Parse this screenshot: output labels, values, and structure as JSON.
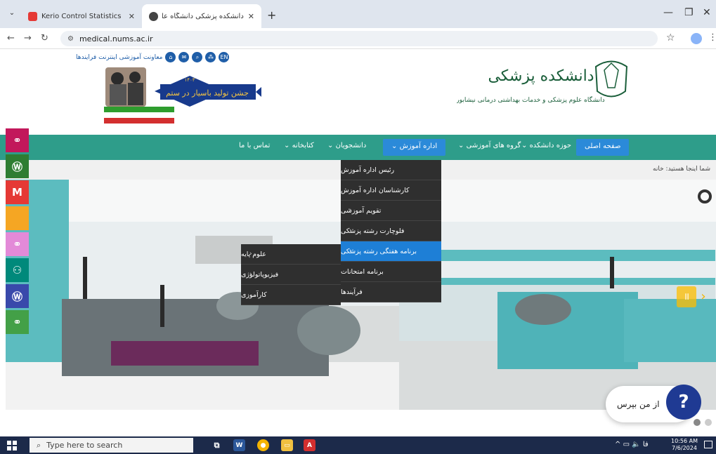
{
  "browser": {
    "tabs": [
      {
        "title": "Kerio Control Statistics",
        "close": "✕"
      },
      {
        "title": "دانشکده پزشکی دانشگاه علوم پز",
        "close": "✕"
      }
    ],
    "new_tab": "+",
    "url": "medical.nums.ac.ir",
    "window_controls": {
      "minimize": "—",
      "maximize": "❐",
      "close": "✕"
    }
  },
  "header": {
    "top_link_text": "معاونت آموزشی اینترنت فرایندها",
    "emblem_title": "جشن تولید باسیار در ستم",
    "emblem_year": "۱۴۰۳",
    "logo_title": "دانشکده پزشکی",
    "logo_subtitle": "دانشگاه علوم پزشکی و خدمات بهداشتی درمانی نیشابور"
  },
  "nav": {
    "items": [
      "صفحه اصلی",
      "حوزه دانشکده",
      "گروه های آموزشی",
      "اداره آموزش",
      "دانشجویان",
      "کتابخانه",
      "تماس با ما"
    ]
  },
  "breadcrumb": "شما اینجا هستید: خانه",
  "dropdown": {
    "items": [
      "رئیس اداره آموزش",
      "کارشناسان اداره آموزش",
      "تقویم آموزشی",
      "فلوچارت رشته پزشکی",
      "برنامه هفتگی رشته پزشکی",
      "برنامه امتحانات",
      "فرآیندها"
    ]
  },
  "submenu": {
    "items": [
      "علوم پایه",
      "فیزیوپاتولوژی",
      "کارآموزی"
    ]
  },
  "ask": {
    "label": "از من بپرس",
    "icon": "?"
  },
  "sidebar_icons": [
    "link-icon",
    "wordpress-icon",
    "m-icon",
    "blank-icon",
    "link-icon",
    "group-icon",
    "wordpress-icon",
    "link-icon"
  ],
  "sidebar_colors": [
    "#c2185b",
    "#2e7d32",
    "#e53935",
    "#f5a623",
    "#e38ad8",
    "#00897b",
    "#3949ab",
    "#43a047"
  ],
  "taskbar": {
    "search_placeholder": "Type here to search",
    "time": "10:56 AM",
    "date": "7/6/2024",
    "lang": "فا"
  }
}
